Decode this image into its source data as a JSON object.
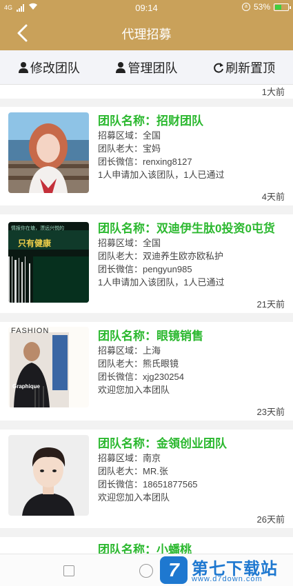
{
  "status_bar": {
    "signal": "4G",
    "time": "09:14",
    "battery_percent": "53%",
    "battery_level": 0.53
  },
  "header": {
    "title": "代理招募",
    "back_icon": "chevron-left-icon"
  },
  "toolbar": {
    "edit_team": "修改团队",
    "manage_team": "管理团队",
    "refresh_top": "刷新置顶"
  },
  "list": {
    "top_time": "1大前",
    "items": [
      {
        "name": "团队名称：招财团队",
        "region": "招募区域：全国",
        "boss": "团队老大：宝妈",
        "wechat": "团长微信：renxing8127",
        "status": "1人申请加入该团队，1人已通过",
        "time": "4天前",
        "thumb": "photo-girl"
      },
      {
        "name": "团队名称：双迪伊生肽0投资0屯货",
        "region": "招募区域：全国",
        "boss": "团队老大：双迪养生欧亦欧私护",
        "wechat": "团长微信：pengyun985",
        "status": "1人申请加入该团队，1人已通过",
        "time": "21天前",
        "thumb": "photo-health",
        "thumb_text_1": "情报你在塘，漂远兴悦的",
        "thumb_text_2": "只有健康"
      },
      {
        "name": "团队名称：眼镜销售",
        "region": "招募区域：上海",
        "boss": "团队老大：熊氏眼镜",
        "wechat": "团长微信：xjg230254",
        "status": "欢迎您加入本团队",
        "time": "23天前",
        "thumb": "photo-fashion",
        "thumb_text_1": "FASHION",
        "thumb_text_2": "Graphique"
      },
      {
        "name": "团队名称：金領创业团队",
        "region": "招募区域：南京",
        "boss": "团队老大：MR.张",
        "wechat": "团长微信：18651877565",
        "status": "欢迎您加入本团队",
        "time": "26天前",
        "thumb": "photo-cartoon-man"
      },
      {
        "name": "团队名称：小蟠桃",
        "thumb": "photo-cartoon"
      }
    ]
  },
  "watermark": {
    "badge": "7",
    "title": "第七下载站",
    "url": "www.d7down.com"
  },
  "colors": {
    "header": "#c9a15a",
    "team_name": "#2bb82f",
    "watermark": "#1e78d0"
  }
}
